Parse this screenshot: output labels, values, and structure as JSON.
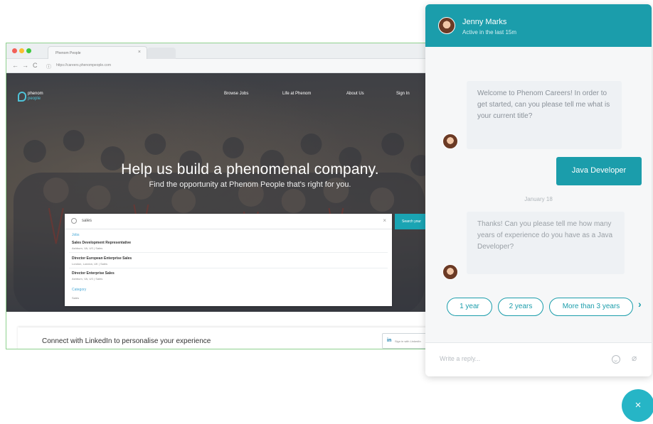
{
  "browser": {
    "tab_title": "Phenom People",
    "tab_close": "×",
    "url": "https://careers.phenompeople.com",
    "nav": {
      "back": "←",
      "forward": "→",
      "reload": "C",
      "info": "ⓘ"
    }
  },
  "site": {
    "logo_line1": "phenom",
    "logo_line2": "people",
    "nav": [
      "Browse Jobs",
      "Life at Phenom",
      "About Us",
      "Sign In"
    ],
    "hero_title": "Help us build a phenomenal company.",
    "hero_subtitle": "Find the opportunity at Phenom People that's right for you.",
    "search": {
      "value": "sales",
      "clear": "×",
      "button": "Search your",
      "groups": [
        {
          "label": "Jobs"
        },
        {
          "label": "Category"
        }
      ],
      "results": [
        {
          "title": "Sales Development Representative",
          "meta": "Ashburn, VA, US  |  Sales"
        },
        {
          "title": "Director European Enterprise Sales",
          "meta": "London, London, UK  |  Sales"
        },
        {
          "title": "Director Enterprise Sales",
          "meta": "Ashburn, VA, US  |  Sales"
        }
      ],
      "category_item": "Sales"
    },
    "linkedin": {
      "text": "Connect with LinkedIn to personalise your experience",
      "icon": "in",
      "button": "Sign in with LinkedIn"
    }
  },
  "chat": {
    "agent_name": "Jenny Marks",
    "agent_status": "Active in the last 15m",
    "messages": {
      "welcome": "Welcome to Phenom Careers! In order to get started, can you please tell me what is your current title?",
      "user_reply": "Java Developer",
      "date": "January 18",
      "followup": "Thanks! Can you please tell me how many years of  experience do you have as a Java Developer?"
    },
    "quick_replies": [
      "1 year",
      "2 years",
      "More than 3 years"
    ],
    "quick_next": "›",
    "composer_placeholder": "Write a reply...",
    "attach": "⌀",
    "fab": "×"
  },
  "colors": {
    "accent": "#1b9dab",
    "fab": "#26b5c6",
    "link": "#4aa9d6"
  }
}
